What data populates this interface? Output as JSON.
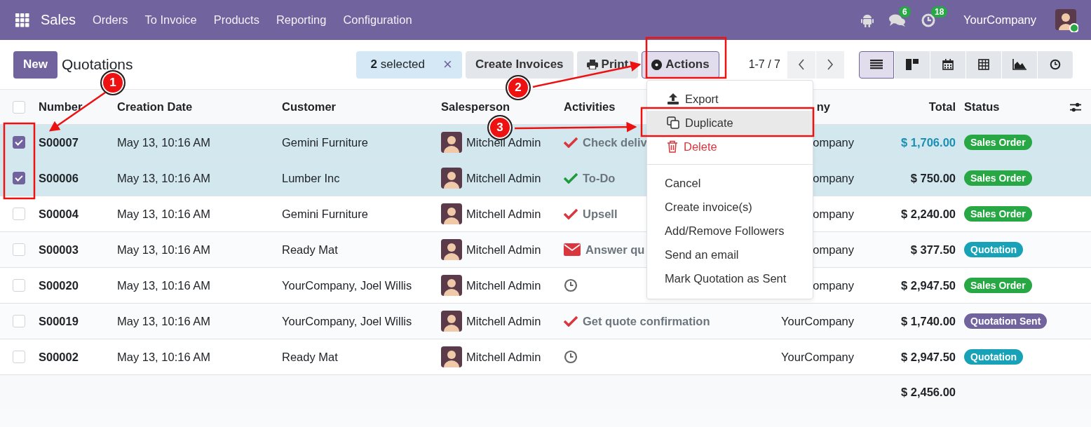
{
  "navbar": {
    "app": "Sales",
    "menu": [
      "Orders",
      "To Invoice",
      "Products",
      "Reporting",
      "Configuration"
    ],
    "messages_badge": "6",
    "activities_badge": "18",
    "company": "YourCompany"
  },
  "control": {
    "new_button": "New",
    "title": "Quotations",
    "selection": "**2** selected",
    "clear": "×",
    "create_invoices": "Create Invoices",
    "print": "Print",
    "actions": {
      "label": "Actions",
      "open": true
    },
    "pager": "1-7 / 7",
    "views": [
      {
        "kind": "list",
        "selected": true
      },
      {
        "kind": "kanban",
        "selected": false
      },
      {
        "kind": "calendar",
        "selected": false
      },
      {
        "kind": "pivot",
        "selected": false
      },
      {
        "kind": "graph",
        "selected": false
      },
      {
        "kind": "activity",
        "selected": false
      }
    ]
  },
  "table": {
    "all_selected": false,
    "columns": [
      "Number",
      "Creation Date",
      "Customer",
      "Salesperson",
      "Activities",
      "ny",
      "Total",
      "Status"
    ],
    "rows": [
      {
        "selected": true,
        "hovered": true,
        "number": "S00007",
        "date": "May 13, 10:16 AM",
        "customer": "Gemini Furniture",
        "salesperson": "Mitchell Admin",
        "activity": {
          "kind": "check",
          "color": "#d9363e",
          "label": "Check deliv"
        },
        "company": "ompany",
        "total": "$ 1,706.00",
        "status": {
          "label": "Sales Order",
          "color": "#28a745"
        }
      },
      {
        "selected": true,
        "hovered": false,
        "number": "S00006",
        "date": "May 13, 10:16 AM",
        "customer": "Lumber Inc",
        "salesperson": "Mitchell Admin",
        "activity": {
          "kind": "check",
          "color": "#1e9b3a",
          "label": "To-Do"
        },
        "company": "ompany",
        "total": "$ 750.00",
        "status": {
          "label": "Sales Order",
          "color": "#28a745"
        }
      },
      {
        "selected": false,
        "hovered": false,
        "number": "S00004",
        "date": "May 13, 10:16 AM",
        "customer": "Gemini Furniture",
        "salesperson": "Mitchell Admin",
        "activity": {
          "kind": "check",
          "color": "#d9363e",
          "label": "Upsell"
        },
        "company": "ompany",
        "total": "$ 2,240.00",
        "status": {
          "label": "Sales Order",
          "color": "#28a745"
        }
      },
      {
        "selected": false,
        "hovered": false,
        "number": "S00003",
        "date": "May 13, 10:16 AM",
        "customer": "Ready Mat",
        "salesperson": "Mitchell Admin",
        "activity": {
          "kind": "envelope",
          "color": "#d9363e",
          "label": "Answer qu"
        },
        "company": "ompany",
        "total": "$ 377.50",
        "status": {
          "label": "Quotation",
          "color": "#17a2b8"
        }
      },
      {
        "selected": false,
        "hovered": false,
        "number": "S00020",
        "date": "May 13, 10:16 AM",
        "customer": "YourCompany, Joel Willis",
        "salesperson": "Mitchell Admin",
        "activity": {
          "kind": "clock"
        },
        "company": "ompany",
        "total": "$ 2,947.50",
        "status": {
          "label": "Sales Order",
          "color": "#28a745"
        }
      },
      {
        "selected": false,
        "hovered": false,
        "number": "S00019",
        "date": "May 13, 10:16 AM",
        "customer": "YourCompany, Joel Willis",
        "salesperson": "Mitchell Admin",
        "activity": {
          "kind": "check",
          "color": "#d9363e",
          "label": "Get quote confirmation"
        },
        "company": "YourCompany",
        "total": "$ 1,740.00",
        "status": {
          "label": "Quotation Sent",
          "color": "#71639e"
        }
      },
      {
        "selected": false,
        "hovered": false,
        "number": "S00002",
        "date": "May 13, 10:16 AM",
        "customer": "Ready Mat",
        "salesperson": "Mitchell Admin",
        "activity": {
          "kind": "clock"
        },
        "company": "YourCompany",
        "total": "$ 2,947.50",
        "status": {
          "label": "Quotation",
          "color": "#17a2b8"
        }
      }
    ],
    "footer_total": "$ 2,456.00"
  },
  "menu": {
    "groups": [
      [
        {
          "label": "Export",
          "kind": "export",
          "highlighted": false
        },
        {
          "label": "Duplicate",
          "kind": "duplicate",
          "highlighted": true
        },
        {
          "label": "Delete",
          "kind": "delete",
          "highlighted": false
        }
      ],
      [
        {
          "label": "Cancel",
          "kind": "plain",
          "highlighted": false
        },
        {
          "label": "Create invoice(s)",
          "kind": "plain",
          "highlighted": false
        },
        {
          "label": "Add/Remove Followers",
          "kind": "plain",
          "highlighted": false
        },
        {
          "label": "Send an email",
          "kind": "plain",
          "highlighted": false
        },
        {
          "label": "Mark Quotation as Sent",
          "kind": "plain",
          "highlighted": false
        }
      ]
    ]
  },
  "annotations": [
    {
      "label": "1"
    },
    {
      "label": "2"
    },
    {
      "label": "3"
    }
  ]
}
